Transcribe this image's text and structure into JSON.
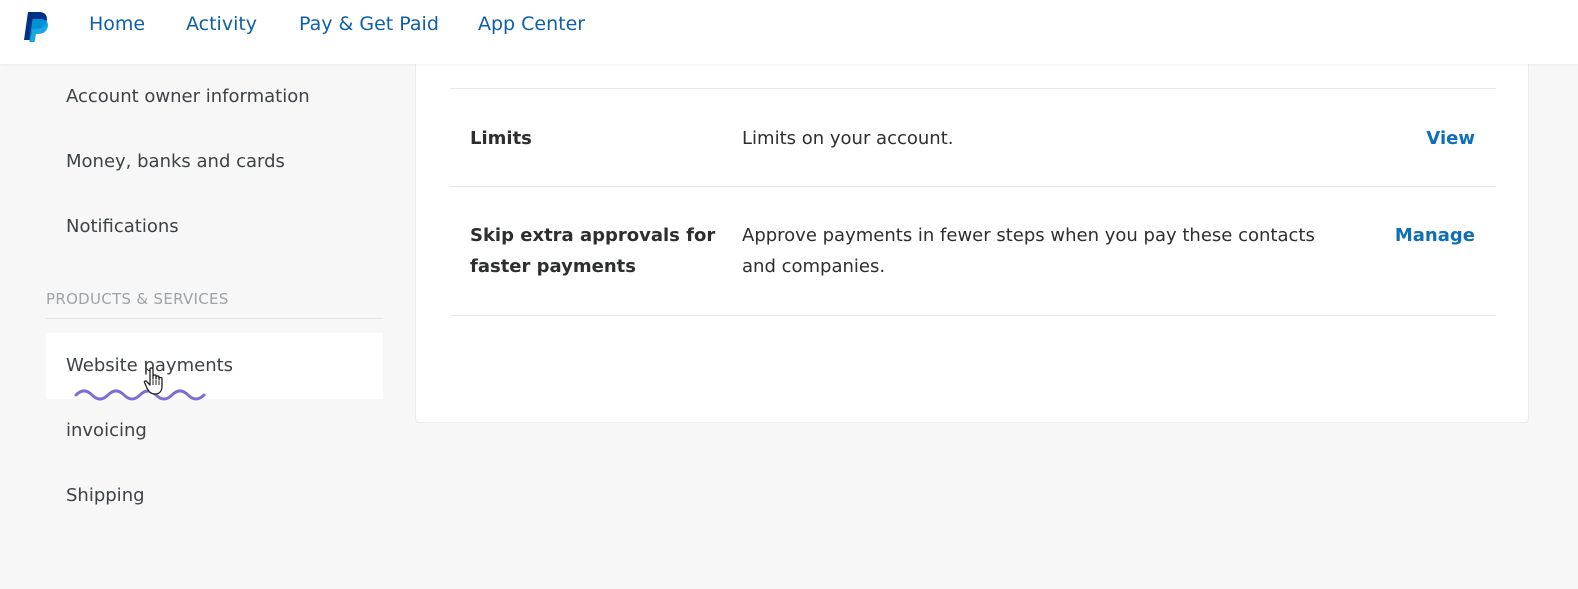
{
  "colors": {
    "nav_link": "#0e5fa6",
    "action_link": "#0e6fb5",
    "sidebar_text": "#3d4246",
    "section_label": "#9da3a6",
    "page_bg": "#f7f7f7",
    "card_bg": "#ffffff",
    "squiggle": "#7b6fd6",
    "logo_dark": "#003087",
    "logo_light": "#009cde"
  },
  "header": {
    "logo_icon": "paypal-logo",
    "nav": [
      {
        "label": "Home"
      },
      {
        "label": "Activity"
      },
      {
        "label": "Pay & Get Paid"
      },
      {
        "label": "App Center"
      }
    ]
  },
  "sidebar": {
    "items_top": [
      {
        "label": "Account owner information"
      },
      {
        "label": "Money, banks and cards"
      },
      {
        "label": "Notifications"
      }
    ],
    "section_label": "PRODUCTS & SERVICES",
    "items_products": [
      {
        "label": "Website payments"
      },
      {
        "label": "invoicing"
      },
      {
        "label": "Shipping"
      }
    ]
  },
  "main": {
    "rows": [
      {
        "title": "Limits",
        "description": "Limits on your account.",
        "action": "View"
      },
      {
        "title_line1": "Skip extra approvals for",
        "title_line2": "faster payments",
        "description_line1": "Approve payments in fewer steps when you pay these contacts",
        "description_line2": "and companies.",
        "action": "Manage"
      }
    ]
  },
  "overlay_icons": {
    "cursor": "hand-pointer-icon",
    "underline": "squiggle-annotation"
  }
}
